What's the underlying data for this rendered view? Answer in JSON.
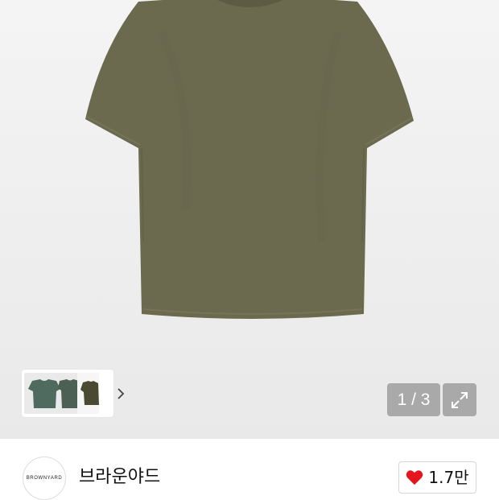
{
  "product": {
    "image_alt": "olive short-sleeve t-shirt",
    "colors": {
      "shirt": "#6b6a4e",
      "shirt_shadow": "#5d5c43",
      "background": "#efefef"
    }
  },
  "gallery": {
    "counter": "1 / 3",
    "thumbnails": [
      {
        "color": "#4f6b5f"
      },
      {
        "color": "#4c6153"
      },
      {
        "color": "#4a4a33"
      }
    ],
    "next_icon": "chevron-right-icon",
    "expand_icon": "expand-icon"
  },
  "brand": {
    "logo_text": "BROWNYARD",
    "name": "브라운야드"
  },
  "like": {
    "icon": "heart-icon",
    "icon_color": "#e5151d",
    "count": "1.7만"
  }
}
